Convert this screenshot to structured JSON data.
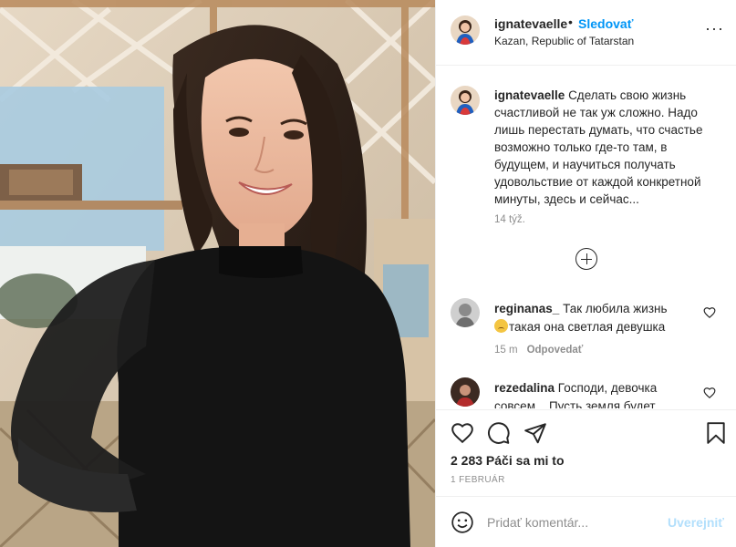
{
  "header": {
    "username": "ignatevaelle",
    "dot": "•",
    "follow_label": "Sledovať",
    "location": "Kazan, Republic of Tatarstan",
    "more_label": "···"
  },
  "caption": {
    "username": "ignatevaelle",
    "text": "Сделать свою жизнь счастливой не так уж сложно. Надо лишь перестать думать, что счастье возможно только где-то там, в будущем, и научиться получать удовольствие от каждой конкретной минуты, здесь и сейчас...",
    "time": "14 týž."
  },
  "comments": [
    {
      "username": "reginanas_",
      "text_before": "Так любила жизнь",
      "emoji": "worried-face-emoji",
      "text_after": "такая она светлая девушка",
      "time": "15 m",
      "reply_label": "Odpovedať"
    },
    {
      "username": "rezedalina",
      "text": "Господи, девочка совсем... Пусть земля будет"
    }
  ],
  "actions": {
    "likes": "2 283 Páči sa mi to",
    "date": "1 FEBRUÁR"
  },
  "add_comment": {
    "placeholder": "Pridať komentár...",
    "post_label": "Uverejniť"
  },
  "icons": {
    "like": "heart-icon",
    "comment": "comment-icon",
    "share": "paper-plane-icon",
    "save": "bookmark-icon",
    "emoji": "smiley-icon",
    "load_more": "plus-circle-icon"
  },
  "colors": {
    "accent": "#0095f6",
    "muted": "#8e8e8e",
    "post_disabled": "#b2dffc",
    "text": "#262626"
  }
}
